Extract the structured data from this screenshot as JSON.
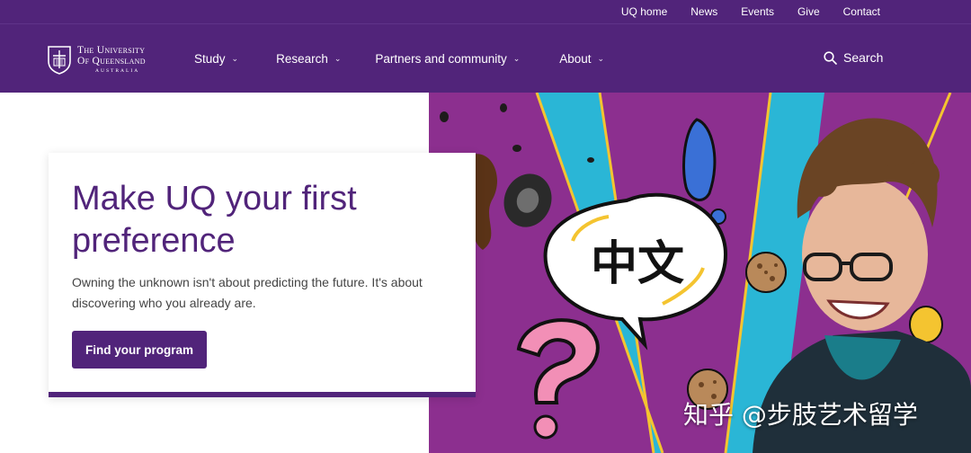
{
  "utility_nav": {
    "items": [
      "UQ home",
      "News",
      "Events",
      "Give",
      "Contact"
    ]
  },
  "logo": {
    "line1": "The University",
    "line2": "Of Queensland",
    "line3": "Australia"
  },
  "main_nav": {
    "items": [
      {
        "label": "Study",
        "icon": "chevron-down-icon"
      },
      {
        "label": "Research",
        "icon": "chevron-down-icon"
      },
      {
        "label": "Partners and community",
        "icon": "chevron-down-icon"
      },
      {
        "label": "About",
        "icon": "chevron-down-icon"
      }
    ],
    "search_label": "Search"
  },
  "hero": {
    "title": "Make UQ your first preference",
    "text": "Owning the unknown isn't about predicting the future. It's about discovering who you already are.",
    "button_label": "Find your program",
    "speech_bubble_text": "中文"
  },
  "watermark": "知乎 @步肢艺术留学",
  "colors": {
    "brand_purple": "#51247a",
    "hero_cyan": "#2ab6d6",
    "hero_magenta": "#8c2f8f"
  }
}
